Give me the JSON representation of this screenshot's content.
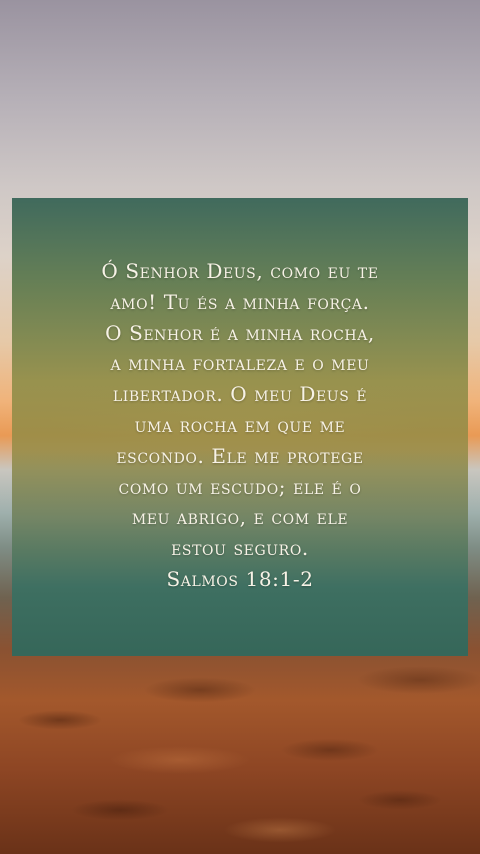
{
  "quote": {
    "lines": [
      "Ó Senhor Deus, como eu te",
      "amo! Tu és a minha força.",
      "O Senhor é a minha rocha,",
      "a minha fortaleza e o meu",
      "libertador. O meu Deus é",
      "uma rocha em que me",
      "escondo. Ele me protege",
      "como um escudo; ele é o",
      "meu abrigo, e com ele",
      "estou seguro."
    ],
    "reference": "Salmos 18:1-2"
  }
}
